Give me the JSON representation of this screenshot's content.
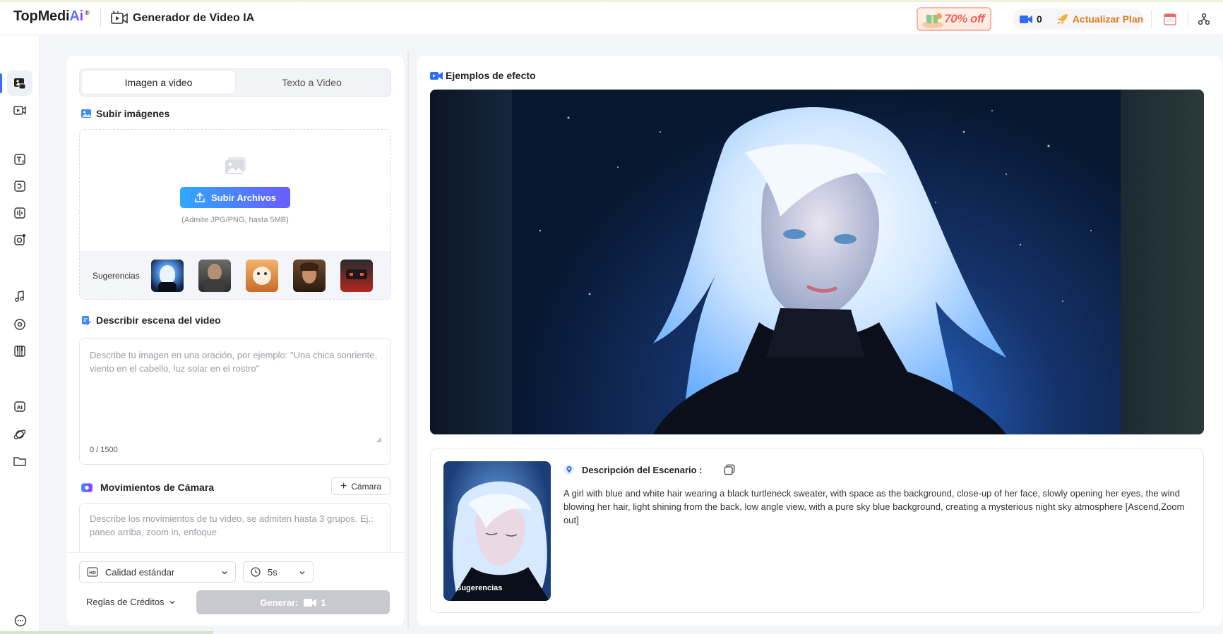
{
  "header": {
    "logo_main": "TopMedi",
    "logo_ai": "Ai",
    "logo_reg": "®",
    "app_title": "Generador de Video IA",
    "promo_text": "70% off",
    "credits": "0",
    "upgrade_label": "Actualizar Plan"
  },
  "tabs": [
    {
      "label": "Imagen a video",
      "active": true
    },
    {
      "label": "Texto a Video",
      "active": false
    }
  ],
  "upload": {
    "section_title": "Subir imágenes",
    "button_label": "Subir Archivos",
    "hint": "(Admite JPG/PNG, hasta 5MB)",
    "suggestions_label": "Sugerencias"
  },
  "scene": {
    "section_title": "Describir escena del video",
    "placeholder": "Describe tu imagen en una oración, por ejemplo: \"Una chica sonriente, viento en el cabello, luz solar en el rostro\"",
    "char_count": "0 / 1500"
  },
  "camera": {
    "section_title": "Movimientos de Cámara",
    "button_label": "Cámara",
    "placeholder": "Describe los movimientos de tu video, se admiten hasta 3 grupos. Ej.: paneo arriba, zoom in, enfoque"
  },
  "controls": {
    "quality": "Calidad estándar",
    "duration": "5s",
    "rules_label": "Reglas de Créditos",
    "generate_label": "Generar:",
    "generate_cost": "1"
  },
  "examples": {
    "section_title": "Ejemplos de efecto",
    "thumb_label": "Sugerencias",
    "desc_title": "Descripción del Escenario :",
    "desc_text": "A girl with blue and white hair wearing a black turtleneck sweater, with space as the background, close-up of her face, slowly opening her eyes, the wind blowing her hair, light shining from the back, low angle view, with a pure sky blue background, creating a mysterious night sky atmosphere [Ascend,Zoom out]"
  },
  "colors": {
    "accent": "#3b6cff",
    "upload_gradient_start": "#2fa8ff",
    "upload_gradient_end": "#6a5cff",
    "promo": "#ff5a4f",
    "upgrade": "#e07a1f"
  }
}
